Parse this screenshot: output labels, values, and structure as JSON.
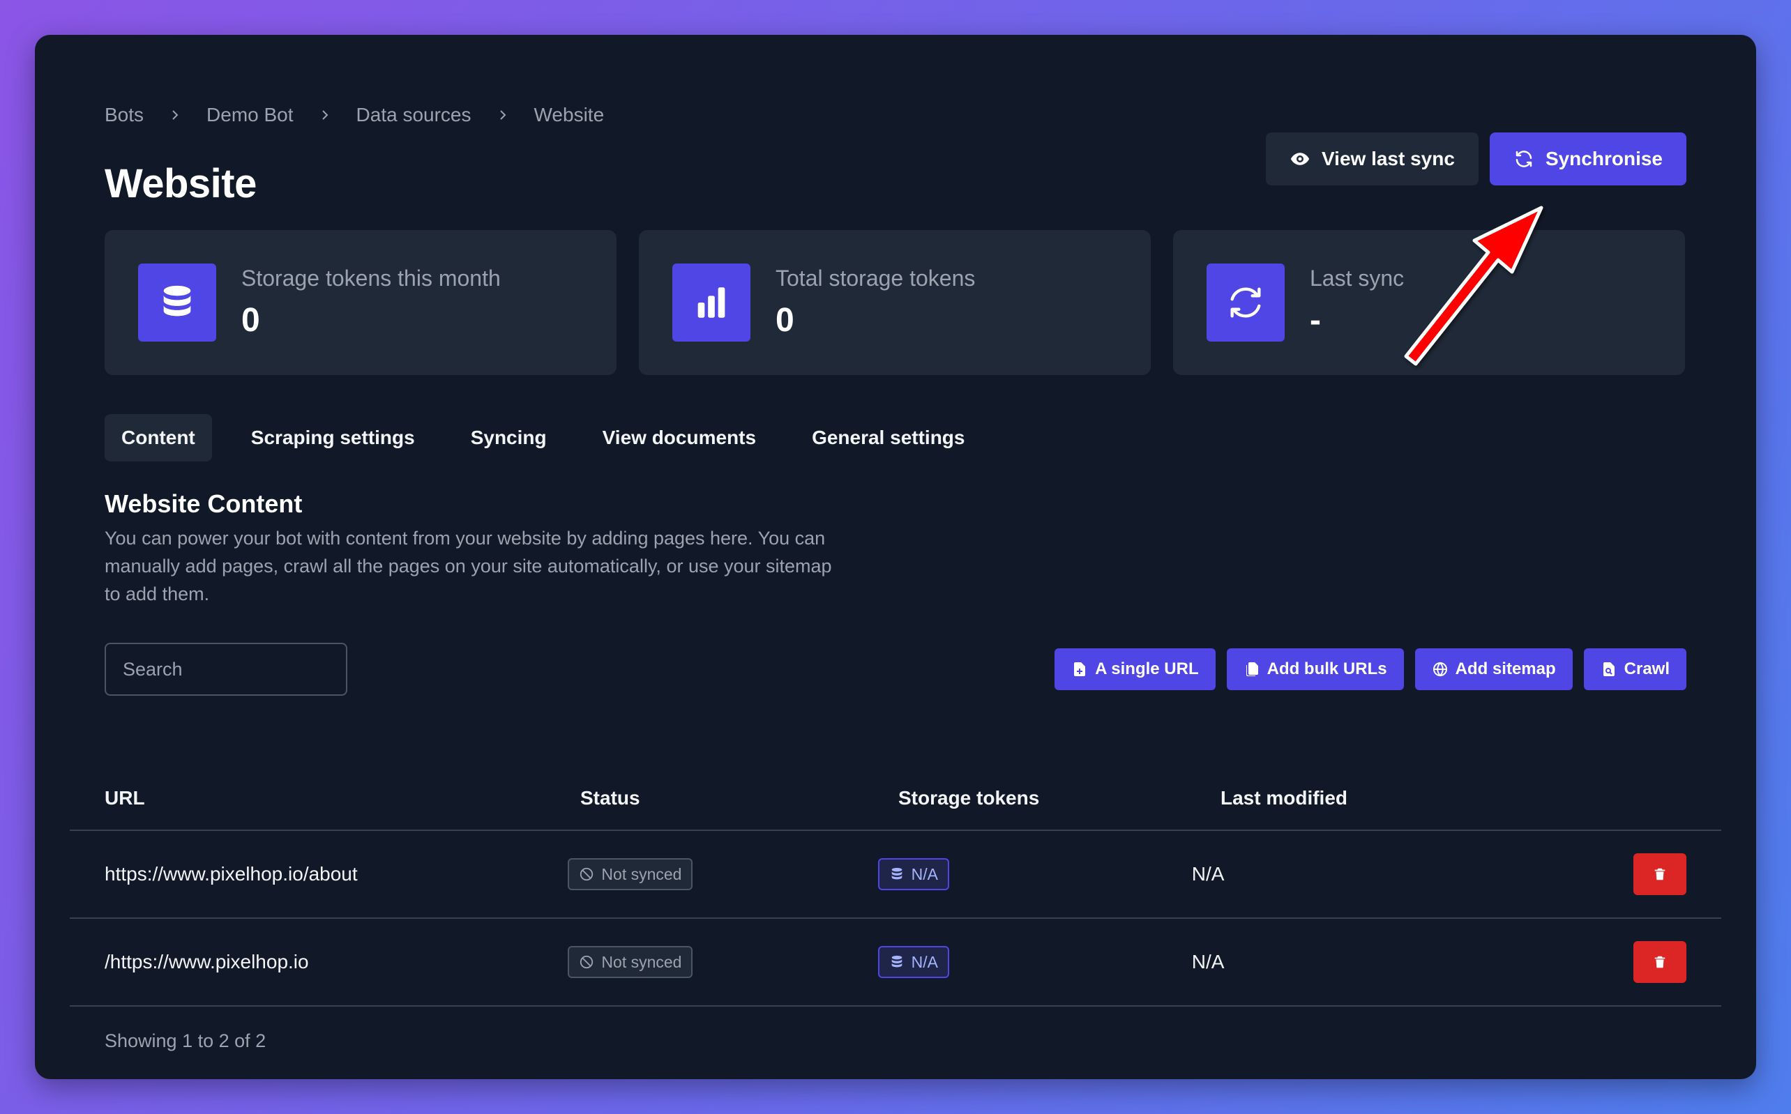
{
  "breadcrumb": [
    "Bots",
    "Demo Bot",
    "Data sources",
    "Website"
  ],
  "page": {
    "title": "Website"
  },
  "top_actions": {
    "view_last_sync": "View last sync",
    "synchronise": "Synchronise"
  },
  "stats": [
    {
      "label": "Storage tokens this month",
      "value": "0",
      "icon": "database-icon"
    },
    {
      "label": "Total storage tokens",
      "value": "0",
      "icon": "bar-chart-icon"
    },
    {
      "label": "Last sync",
      "value": "-",
      "icon": "sync-icon"
    }
  ],
  "tabs": [
    "Content",
    "Scraping settings",
    "Syncing",
    "View documents",
    "General settings"
  ],
  "active_tab": "Content",
  "section": {
    "title": "Website Content",
    "description": "You can power your bot with content from your website by adding pages here. You can manually add pages, crawl all the pages on your site automatically, or use your sitemap to add them."
  },
  "search": {
    "placeholder": "Search",
    "value": ""
  },
  "add_actions": {
    "single_url": "A single URL",
    "bulk_urls": "Add bulk URLs",
    "sitemap": "Add sitemap",
    "crawl": "Crawl"
  },
  "table": {
    "columns": [
      "URL",
      "Status",
      "Storage tokens",
      "Last modified"
    ],
    "rows": [
      {
        "url": "https://www.pixelhop.io/about",
        "status": "Not synced",
        "tokens": "N/A",
        "modified": "N/A"
      },
      {
        "url": "/https://www.pixelhop.io",
        "status": "Not synced",
        "tokens": "N/A",
        "modified": "N/A"
      }
    ]
  },
  "footer": {
    "showing": "Showing 1 to 2 of 2"
  },
  "colors": {
    "background_gradient": [
      "#8b55e6",
      "#4f7ded"
    ],
    "panel": "#111827",
    "card": "#1f2937",
    "accent": "#4f46e5",
    "danger": "#dc2626",
    "annotation_arrow": "#ff0000"
  }
}
